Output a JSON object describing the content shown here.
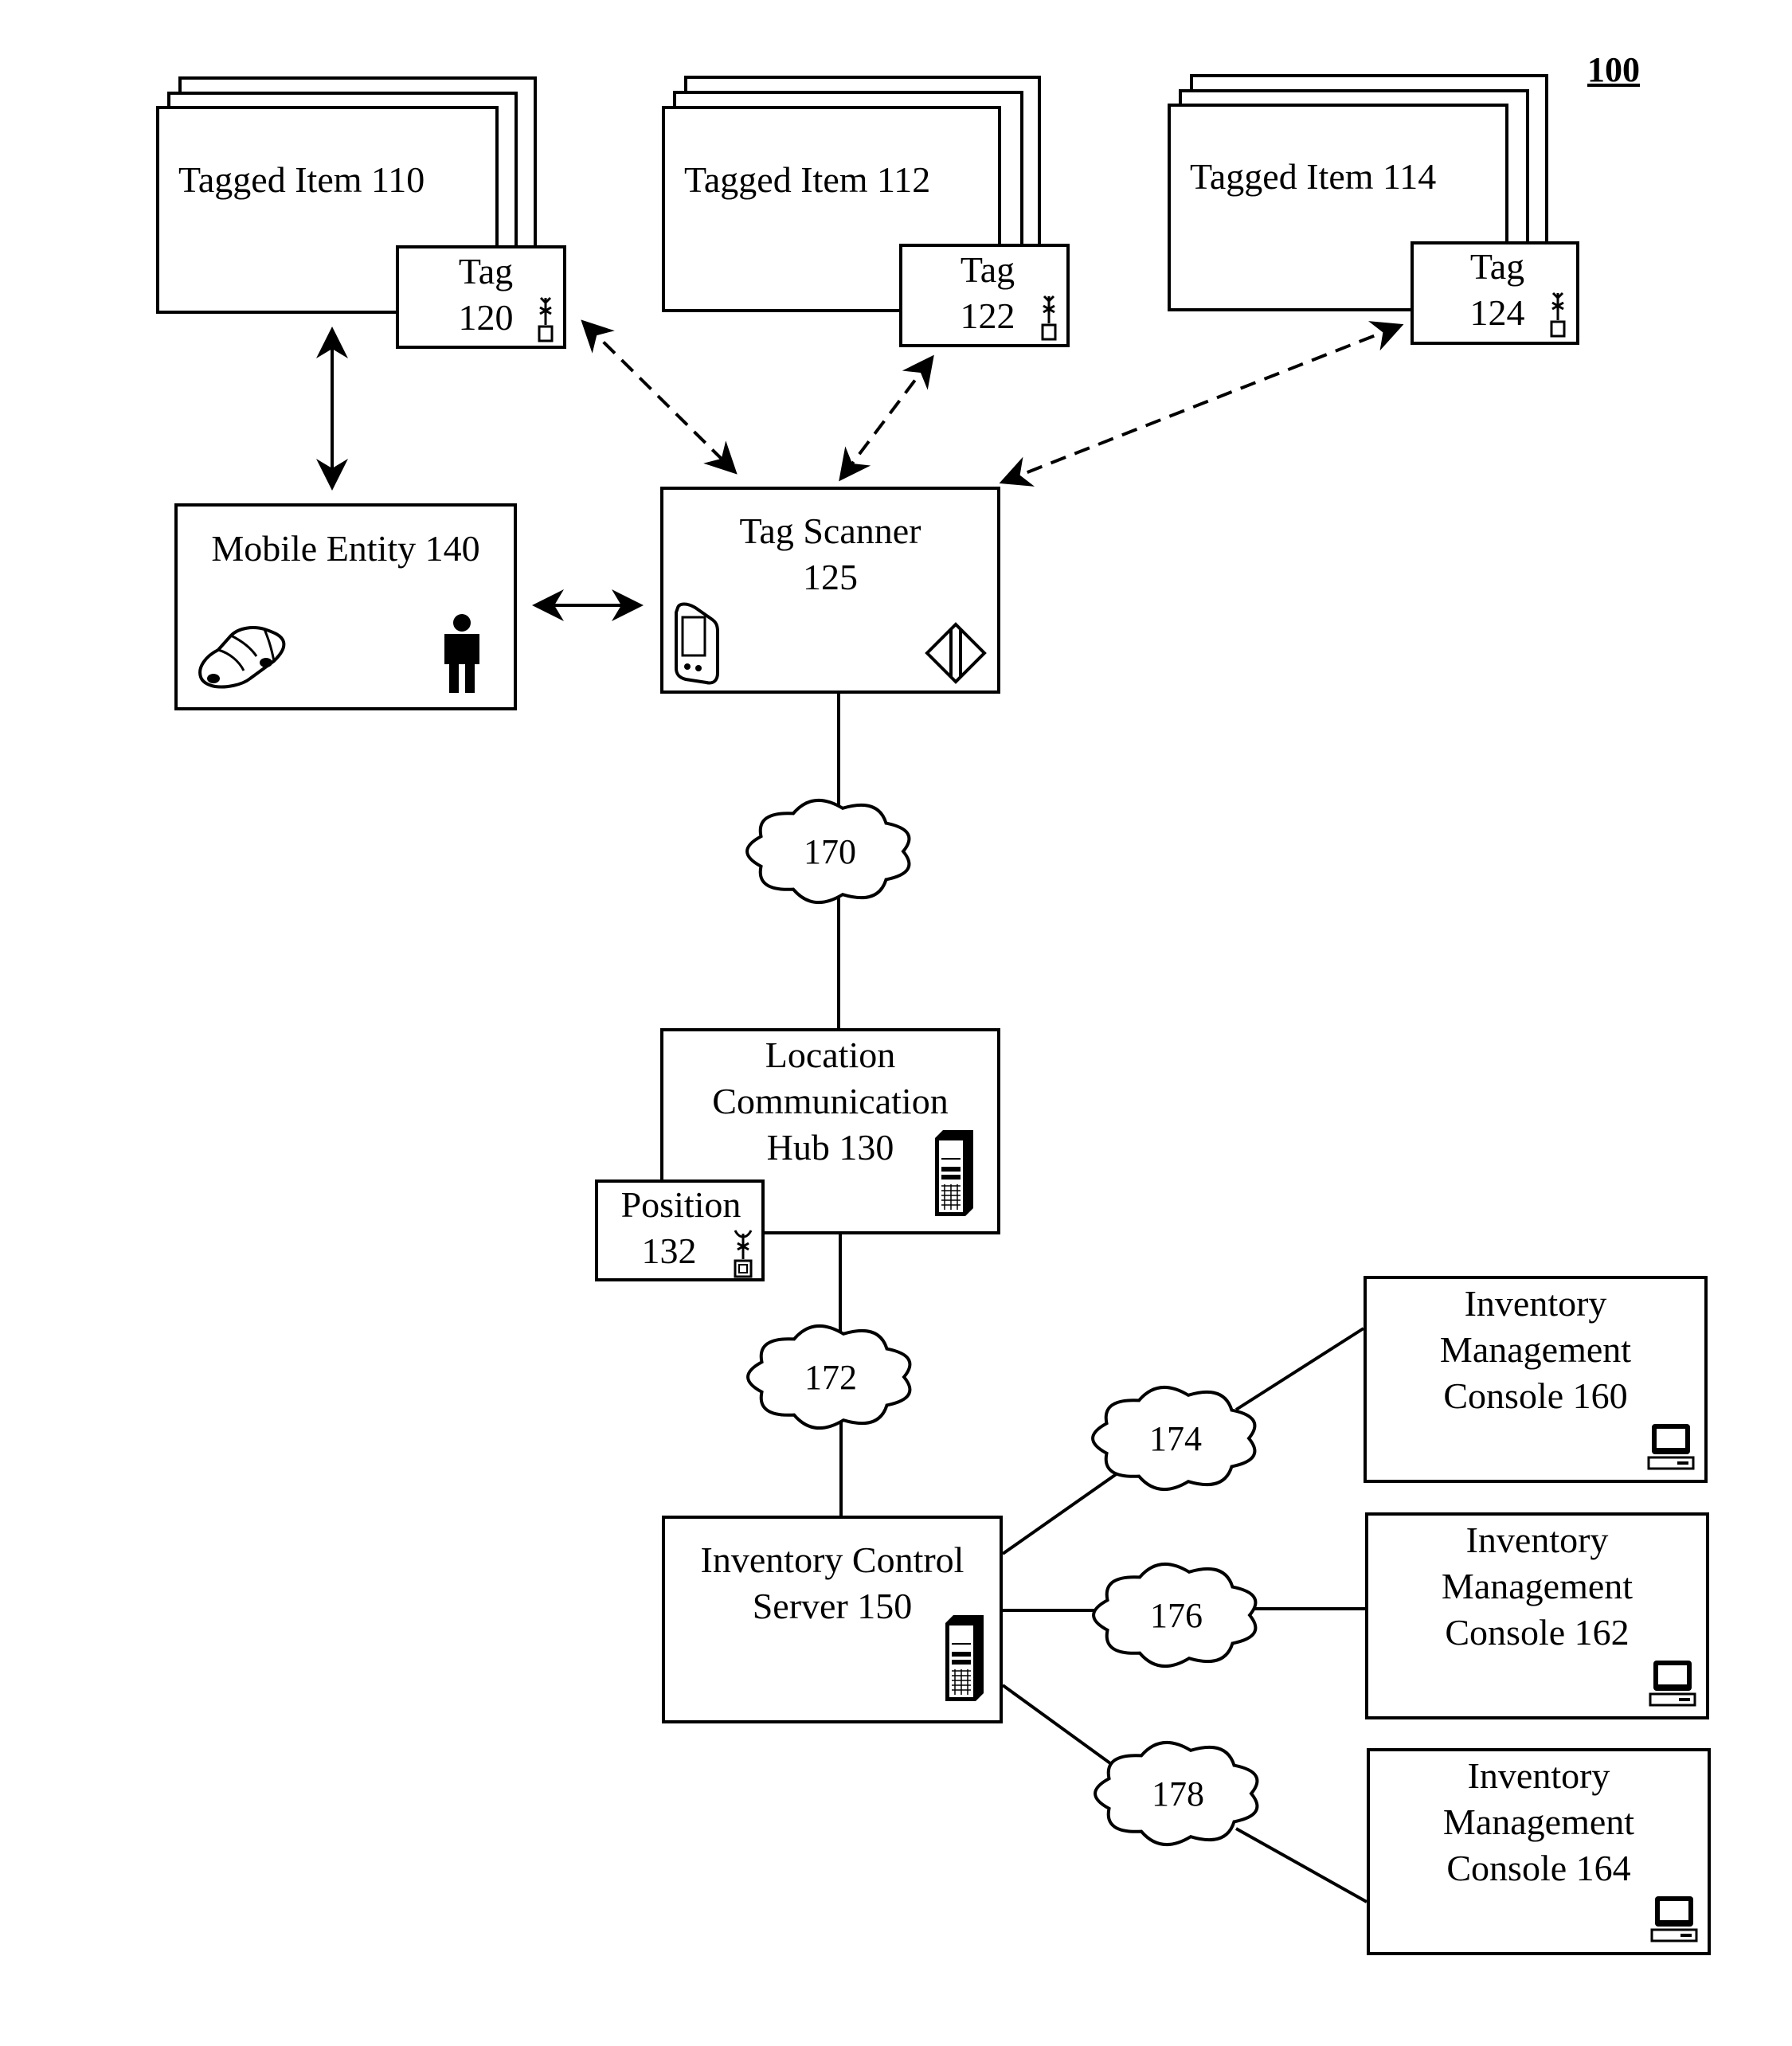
{
  "figure_number": "100",
  "tagged_items": [
    {
      "label": "Tagged Item 110",
      "tag_line1": "Tag",
      "tag_line2": "120"
    },
    {
      "label": "Tagged Item 112",
      "tag_line1": "Tag",
      "tag_line2": "122"
    },
    {
      "label": "Tagged Item 114",
      "tag_line1": "Tag",
      "tag_line2": "124"
    }
  ],
  "mobile_entity": {
    "label": "Mobile Entity 140",
    "icons": [
      "car-icon",
      "person-icon"
    ]
  },
  "tag_scanner": {
    "line1": "Tag Scanner",
    "line2": "125",
    "icons": [
      "handheld-device-icon",
      "scanner-gate-icon"
    ]
  },
  "hub": {
    "line1": "Location",
    "line2": "Communication",
    "line3": "Hub 130",
    "icon": "server-tower-icon"
  },
  "position": {
    "line1": "Position",
    "line2": "132",
    "icon": "antenna-tag-icon"
  },
  "server": {
    "line1": "Inventory Control",
    "line2": "Server 150",
    "icon": "server-tower-icon"
  },
  "networks": [
    "170",
    "172",
    "174",
    "176",
    "178"
  ],
  "consoles": [
    {
      "line1": "Inventory",
      "line2": "Management",
      "line3": "Console 160",
      "icon": "computer-icon"
    },
    {
      "line1": "Inventory",
      "line2": "Management",
      "line3": "Console 162",
      "icon": "computer-icon"
    },
    {
      "line1": "Inventory",
      "line2": "Management",
      "line3": "Console 164",
      "icon": "computer-icon"
    }
  ]
}
